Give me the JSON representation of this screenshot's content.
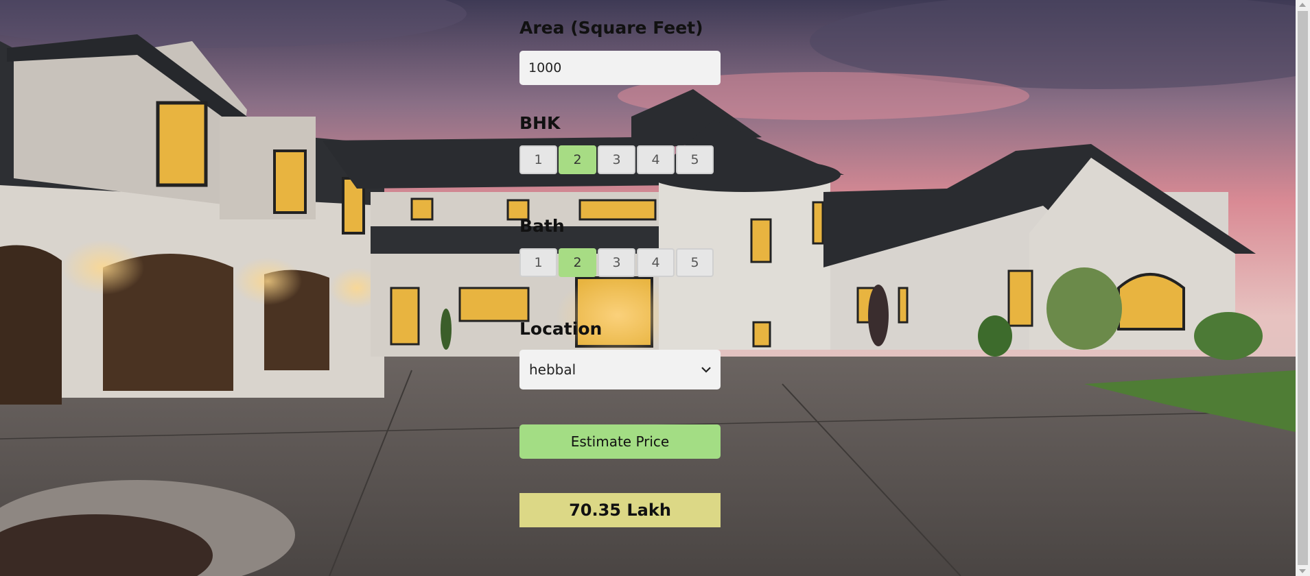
{
  "form": {
    "area": {
      "label": "Area (Square Feet)",
      "value": "1000"
    },
    "bhk": {
      "label": "BHK",
      "options": [
        "1",
        "2",
        "3",
        "4",
        "5"
      ],
      "selected": "2"
    },
    "bath": {
      "label": "Bath",
      "options": [
        "1",
        "2",
        "3",
        "4",
        "5"
      ],
      "selected": "2"
    },
    "location": {
      "label": "Location",
      "value": "hebbal"
    },
    "estimate_button_label": "Estimate Price",
    "result": "70.35 Lakh"
  },
  "colors": {
    "active_option": "#a7dc84",
    "button": "#a3dd84",
    "result_background": "#dcd886"
  },
  "icons": {
    "select_arrow": "chevron-down-icon"
  }
}
